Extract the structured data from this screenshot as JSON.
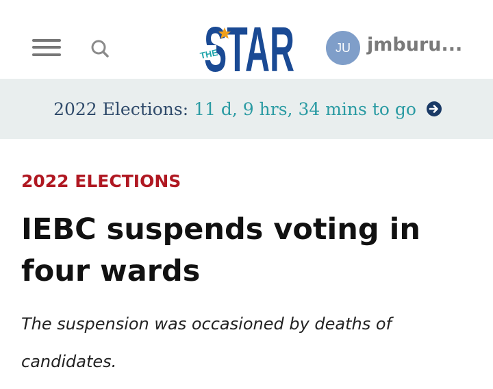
{
  "header": {
    "menu_icon": "hamburger-menu-icon",
    "search_icon": "search-icon",
    "logo": {
      "small_text": "THE",
      "big_text": "STAR",
      "colors": {
        "primary": "#1a4a94",
        "accent": "#f0a01c",
        "tag": "#1da4aa"
      }
    },
    "user": {
      "initials": "JU",
      "name": "jmburu...",
      "avatar_color": "#7f9ec9"
    }
  },
  "countdown": {
    "label": "2022 Elections:",
    "value": "11 d, 9 hrs, 34 mins to go",
    "arrow_icon": "arrow-right-circle-icon",
    "colors": {
      "label": "#2f4a6a",
      "value": "#2b9ba3",
      "background": "#e9eeee"
    }
  },
  "article": {
    "category": "2022 ELECTIONS",
    "title": "IEBC suspends voting in four wards",
    "summary": "The suspension was occasioned by deaths of candidates.",
    "colors": {
      "category": "#b01822",
      "title": "#111111"
    }
  }
}
